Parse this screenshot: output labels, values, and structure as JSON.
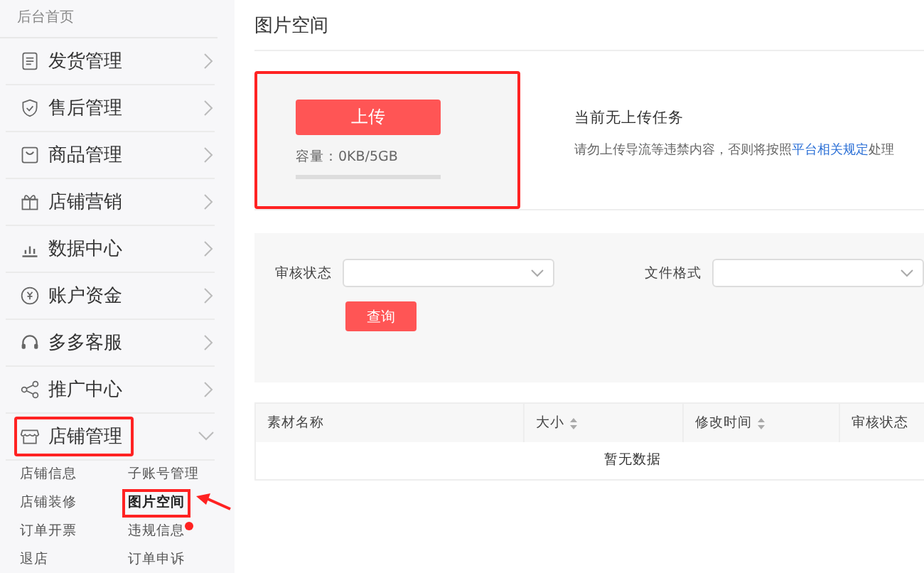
{
  "sidebar": {
    "home": "后台首页",
    "items": [
      {
        "label": "发货管理",
        "expanded": false,
        "highlighted": false
      },
      {
        "label": "售后管理",
        "expanded": false,
        "highlighted": false
      },
      {
        "label": "商品管理",
        "expanded": false,
        "highlighted": false
      },
      {
        "label": "店铺营销",
        "expanded": false,
        "highlighted": false
      },
      {
        "label": "数据中心",
        "expanded": false,
        "highlighted": false
      },
      {
        "label": "账户资金",
        "expanded": false,
        "highlighted": false
      },
      {
        "label": "多多客服",
        "expanded": false,
        "highlighted": false
      },
      {
        "label": "推广中心",
        "expanded": false,
        "highlighted": false
      },
      {
        "label": "店铺管理",
        "expanded": true,
        "highlighted": true,
        "children": [
          {
            "label": "店铺信息",
            "selected": false,
            "badge": false,
            "highlighted": false
          },
          {
            "label": "子账号管理",
            "selected": false,
            "badge": false,
            "highlighted": false
          },
          {
            "label": "店铺装修",
            "selected": false,
            "badge": false,
            "highlighted": false
          },
          {
            "label": "图片空间",
            "selected": true,
            "badge": false,
            "highlighted": true
          },
          {
            "label": "订单开票",
            "selected": false,
            "badge": false,
            "highlighted": false
          },
          {
            "label": "违规信息",
            "selected": false,
            "badge": true,
            "highlighted": false
          },
          {
            "label": "退店",
            "selected": false,
            "badge": false,
            "highlighted": false
          },
          {
            "label": "订单申诉",
            "selected": false,
            "badge": false,
            "highlighted": false
          }
        ]
      }
    ]
  },
  "page_title": "图片空间",
  "upload": {
    "highlighted": true,
    "button": "上传",
    "capacity": "容量：0KB/5GB",
    "status": "当前无上传任务",
    "notice_before": "请勿上传导流等违禁内容，否则将按照",
    "notice_link": "平台相关规定",
    "notice_after": "处理"
  },
  "filters": {
    "fields": [
      {
        "label": "审核状态"
      },
      {
        "label": "文件格式"
      }
    ],
    "query_button": "查询"
  },
  "table": {
    "columns": [
      {
        "label": "素材名称",
        "sortable": false
      },
      {
        "label": "大小",
        "sortable": true
      },
      {
        "label": "修改时间",
        "sortable": true
      },
      {
        "label": "审核状态",
        "sortable": false
      }
    ],
    "empty_text": "暂无数据"
  }
}
